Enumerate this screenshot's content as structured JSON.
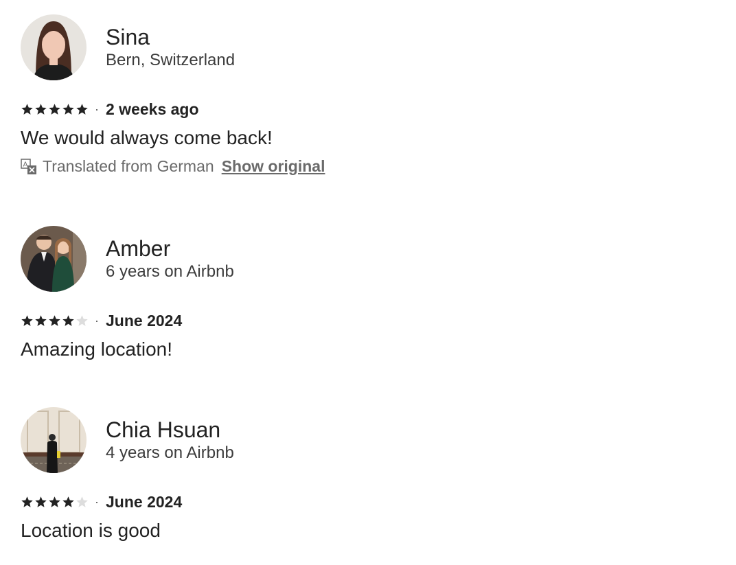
{
  "reviews": [
    {
      "name": "Sina",
      "subtitle": "Bern, Switzerland",
      "rating": 5,
      "date": "2 weeks ago",
      "text": "We would always come back!",
      "translation": {
        "note": "Translated from German",
        "show_original": "Show original"
      }
    },
    {
      "name": "Amber",
      "subtitle": "6 years on Airbnb",
      "rating": 4,
      "date": "June 2024",
      "text": "Amazing location!"
    },
    {
      "name": "Chia Hsuan",
      "subtitle": "4 years on Airbnb",
      "rating": 4,
      "date": "June 2024",
      "text": "Location is good"
    }
  ],
  "separator": "·",
  "colors": {
    "star_filled": "#222222",
    "star_empty": "#dddddd",
    "text": "#222222",
    "muted": "#6a6a6a"
  }
}
